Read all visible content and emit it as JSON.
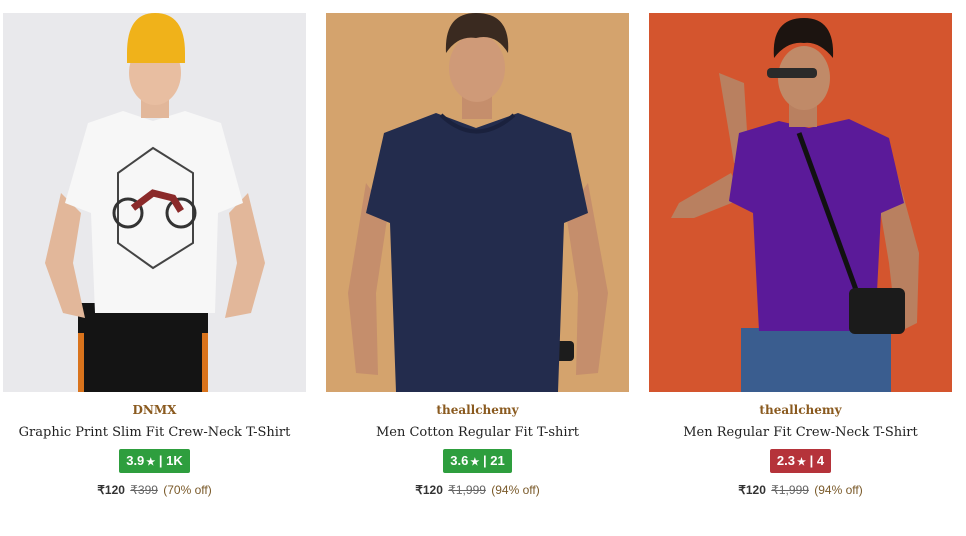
{
  "products": [
    {
      "brand": "DNMX",
      "title": "Graphic Print Slim Fit Crew-Neck T-Shirt",
      "rating": "3.9",
      "reviews": "1K",
      "rating_color": "#2e9e3e",
      "price": "₹120",
      "mrp": "₹399",
      "off": "(70% off)",
      "image_desc_icon": "product-photo-white-tshirt"
    },
    {
      "brand": "theallchemy",
      "title": "Men Cotton Regular Fit T-shirt",
      "rating": "3.6",
      "reviews": "21",
      "rating_color": "#2e9e3e",
      "price": "₹120",
      "mrp": "₹1,999",
      "off": "(94% off)",
      "image_desc_icon": "product-photo-navy-tshirt"
    },
    {
      "brand": "theallchemy",
      "title": "Men Regular Fit Crew-Neck T-Shirt",
      "rating": "2.3",
      "reviews": "4",
      "rating_color": "#b5333a",
      "price": "₹120",
      "mrp": "₹1,999",
      "off": "(94% off)",
      "image_desc_icon": "product-photo-purple-tshirt"
    }
  ],
  "rating_separator": "|",
  "star_glyph": "★"
}
